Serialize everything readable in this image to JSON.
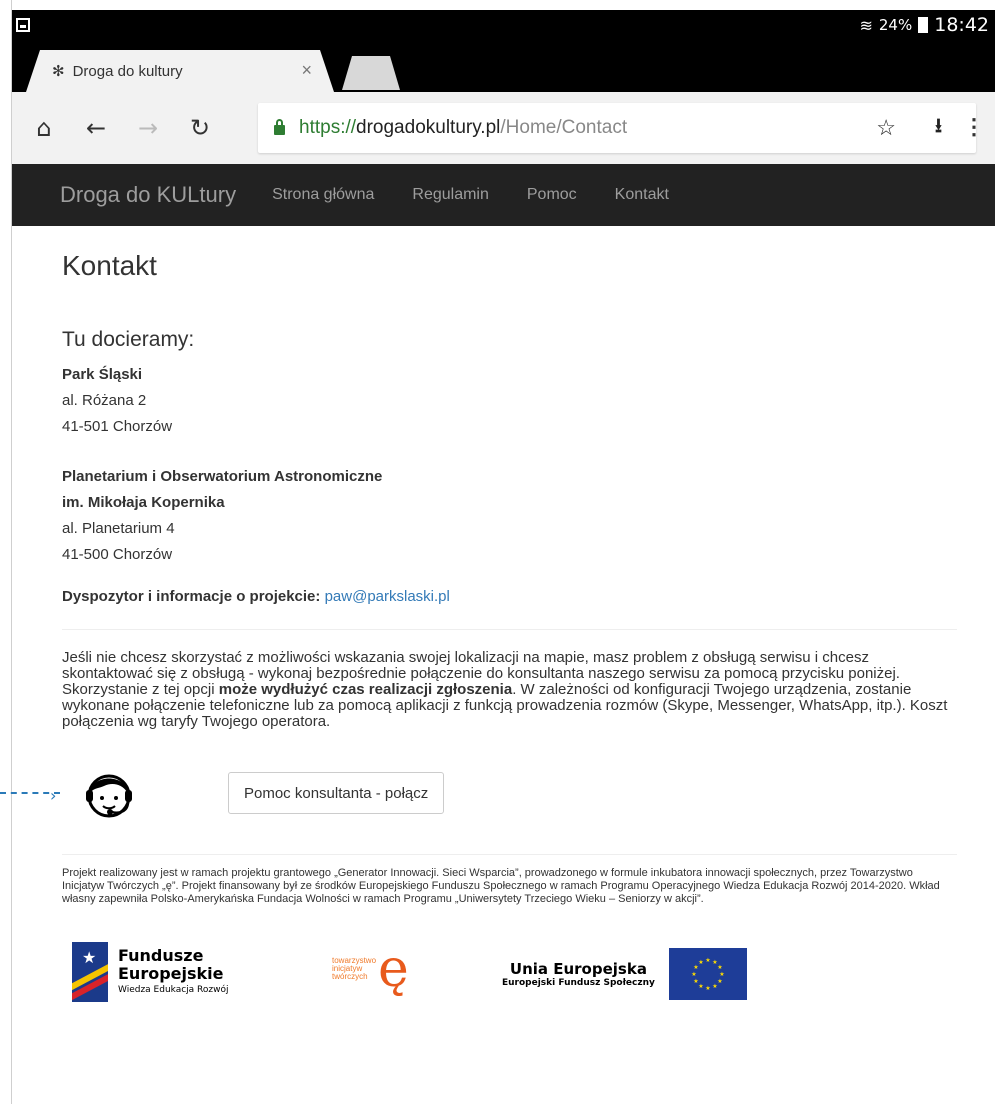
{
  "statusbar": {
    "battery_pct": "24%",
    "time": "18:42"
  },
  "tab": {
    "title": "Droga do kultury",
    "close": "×"
  },
  "toolbar": {
    "url_scheme": "https://",
    "url_host": "drogadokultury.pl",
    "url_path": "/Home/Contact"
  },
  "navbar": {
    "brand": "Droga do KULtury",
    "links": [
      "Strona główna",
      "Regulamin",
      "Pomoc",
      "Kontakt"
    ]
  },
  "main": {
    "title": "Kontakt",
    "subhead": "Tu docieramy:",
    "address1": {
      "name": "Park Śląski",
      "street": "al. Różana 2",
      "city": "41-501 Chorzów"
    },
    "address2": {
      "name_l1": "Planetarium i Obserwatorium Astronomiczne",
      "name_l2": "im. Mikołaja Kopernika",
      "street": "al. Planetarium 4",
      "city": "41-500 Chorzów"
    },
    "dispatch_label": "Dyspozytor i informacje o projekcie:",
    "dispatch_email": "paw@parkslaski.pl",
    "notice_part1": "Jeśli nie chcesz skorzystać z możliwości wskazania swojej lokalizacji na mapie, masz problem z obsługą serwisu i chcesz skontaktować się z obsługą - wykonaj bezpośrednie połączenie do konsultanta naszego serwisu za pomocą przycisku poniżej. Skorzystanie z tej opcji ",
    "notice_bold": "może wydłużyć czas realizacji zgłoszenia",
    "notice_part2": ". W zależności od konfiguracji Twojego urządzenia, zostanie wykonane połączenie telefoniczne lub za pomocą aplikacji z funkcją prowadzenia rozmów (Skype, Messenger, WhatsApp, itp.). Koszt połączenia wg taryfy Twojego operatora.",
    "consult_button": "Pomoc konsultanta - połącz"
  },
  "footer": {
    "text": "Projekt realizowany jest w ramach projektu grantowego „Generator  Innowacji. Sieci Wsparcia”, prowadzonego w formule inkubatora innowacji społecznych, przez Towarzystwo Inicjatyw Twórczych „ę”. Projekt finansowany był ze środków Europejskiego Funduszu Społecznego w ramach Programu Operacyjnego Wiedza Edukacja Rozwój 2014-2020. Wkład własny zapewniła Polsko-Amerykańska Fundacja Wolności w ramach Programu „Uniwersytety Trzeciego Wieku – Seniorzy w akcji”.",
    "logo_fe": {
      "l1": "Fundusze",
      "l2": "Europejskie",
      "l3": "Wiedza Edukacja Rozwój"
    },
    "logo_tit": {
      "l1": "towarzystwo",
      "l2": "inicjatyw",
      "l3": "twórczych",
      "mark": "ę"
    },
    "logo_ue": {
      "l1": "Unia Europejska",
      "l2": "Europejski Fundusz Społeczny"
    }
  },
  "colors": {
    "navbar_bg": "#222222",
    "link": "#337ab7",
    "secure": "#2e7d32",
    "eu_blue": "#1e3d98",
    "eu_star": "#ffdd00"
  }
}
